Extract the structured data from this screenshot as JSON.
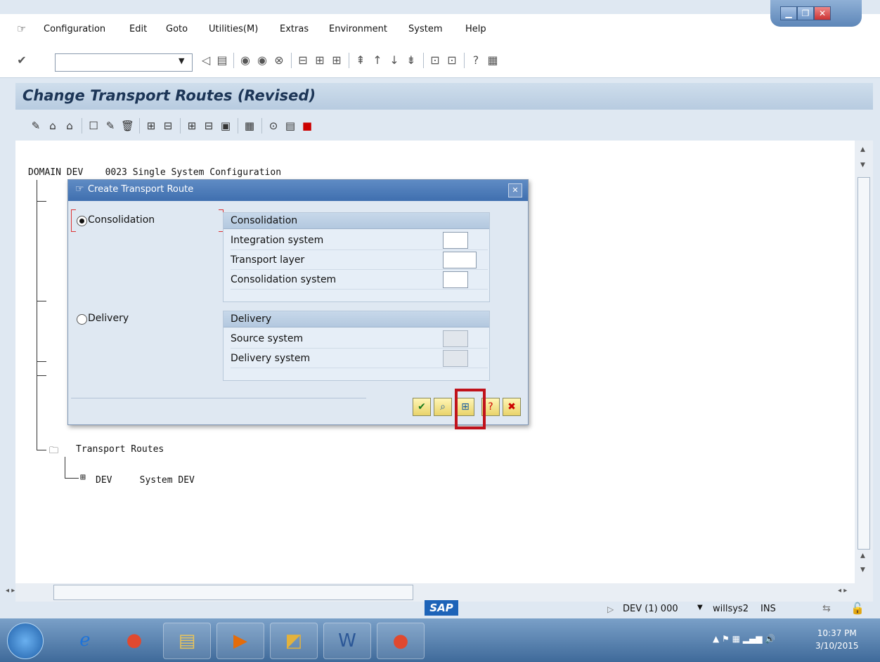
{
  "menu": [
    "Configuration",
    "Edit",
    "Goto",
    "Utilities(M)",
    "Extras",
    "Environment",
    "System",
    "Help"
  ],
  "page_title": "Change Transport Routes (Revised)",
  "tree": {
    "domain_line": "DOMAIN DEV    0023 Single System Configuration",
    "transport_routes": "Transport Routes",
    "dev_node": "DEV     System DEV"
  },
  "dialog": {
    "title": "Create Transport Route",
    "radio_consolidation": "Consolidation",
    "radio_delivery": "Delivery",
    "consolidation_group": {
      "title": "Consolidation",
      "fields": [
        "Integration system",
        "Transport layer",
        "Consolidation system"
      ]
    },
    "delivery_group": {
      "title": "Delivery",
      "fields": [
        "Source system",
        "Delivery system"
      ]
    },
    "highlight_color": "#c0121b"
  },
  "status": {
    "sap_logo": "SAP",
    "session": "DEV (1) 000",
    "user": "willsys2",
    "mode": "INS"
  },
  "taskbar": {
    "time": "10:37 PM",
    "date": "3/10/2015"
  }
}
